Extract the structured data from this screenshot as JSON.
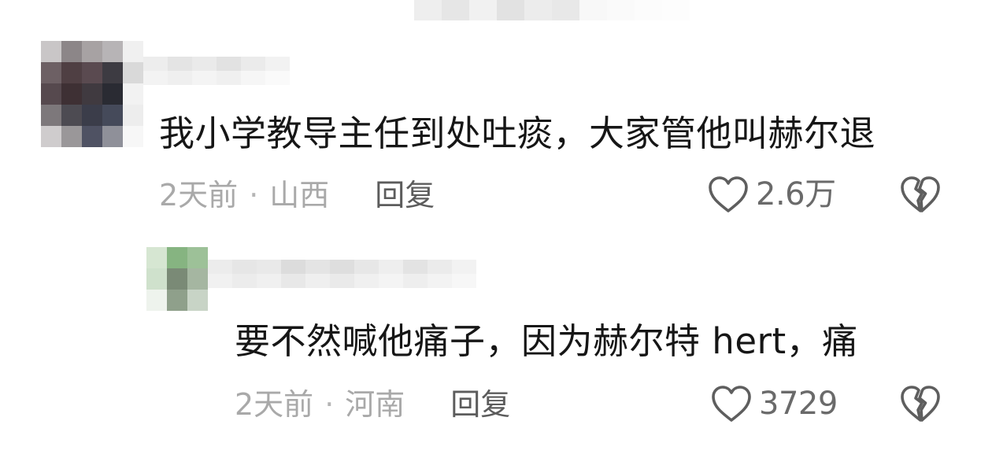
{
  "comments": [
    {
      "text": "我小学教导主任到处吐痰，大家管他叫赫尔退",
      "time": "2天前",
      "separator": "·",
      "location": "山西",
      "reply_label": "回复",
      "likes": "2.6万"
    },
    {
      "text": "要不然喊他痛子，因为赫尔特 hert，痛",
      "time": "2天前",
      "separator": "·",
      "location": "河南",
      "reply_label": "回复",
      "likes": "3729"
    }
  ],
  "icons": {
    "like": "heart-outline-icon",
    "dislike": "broken-heart-icon"
  },
  "colors": {
    "comment_text": "#161616",
    "meta_text": "#a9a9a9",
    "reply_text": "#5c5c5c",
    "icon_stroke": "#5e5e5e"
  }
}
